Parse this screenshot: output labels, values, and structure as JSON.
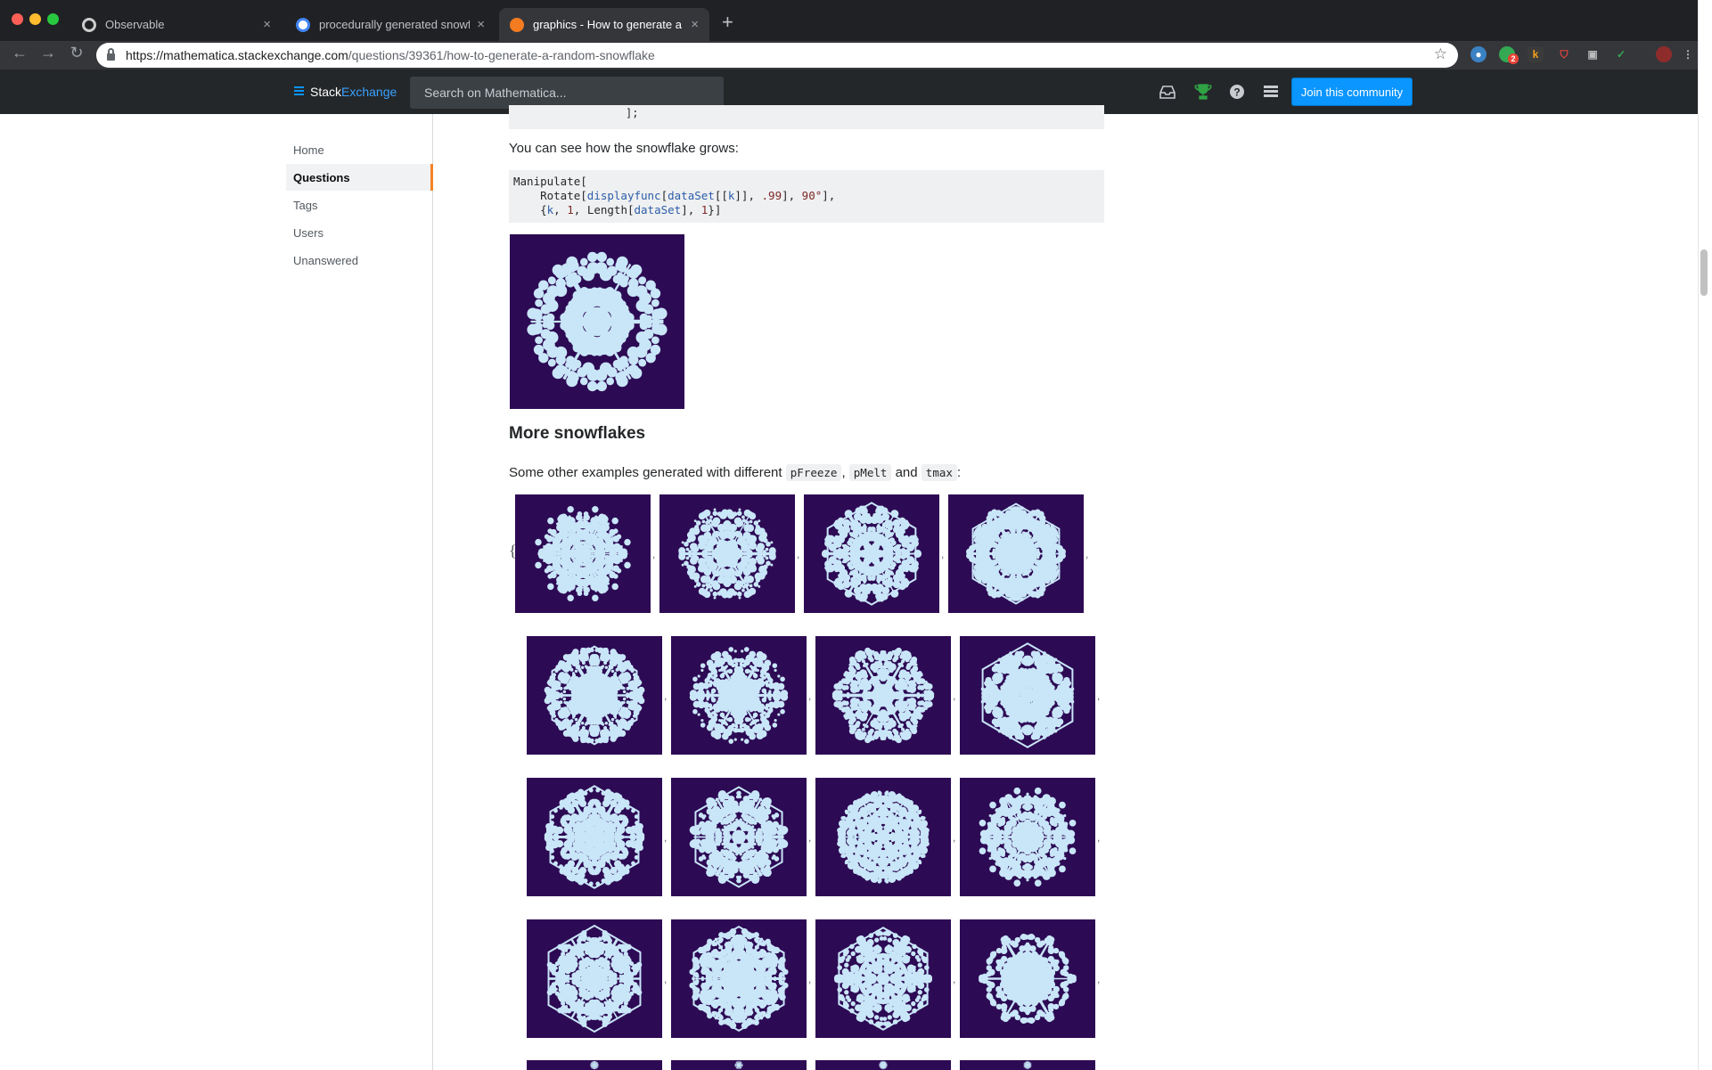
{
  "browser": {
    "tabs": [
      {
        "title": "Observable",
        "active": false
      },
      {
        "title": "procedurally generated snowfl",
        "active": false
      },
      {
        "title": "graphics - How to generate a r",
        "active": true
      }
    ],
    "url_host": "https://mathematica.stackexchange.com",
    "url_path": "/questions/39361/how-to-generate-a-random-snowflake",
    "extension_badge": "2"
  },
  "topbar": {
    "logo_prefix": "Stack",
    "logo_suffix": "Exchange",
    "search_placeholder": "Search on Mathematica...",
    "join_label": "Join this community",
    "icons": [
      "inbox-icon",
      "achievements-icon",
      "help-icon",
      "site-switcher-icon"
    ]
  },
  "sidebar": {
    "items": [
      {
        "label": "Home",
        "active": false
      },
      {
        "label": "Questions",
        "active": true
      },
      {
        "label": "Tags",
        "active": false
      },
      {
        "label": "Users",
        "active": false
      },
      {
        "label": "Unanswered",
        "active": false
      }
    ]
  },
  "post": {
    "code_tail": "];",
    "grow_text": "You can see how the snowflake grows:",
    "manipulate_code": {
      "line1": "Manipulate[",
      "line2_a": "    Rotate[",
      "line2_fn": "displayfunc",
      "line2_b": "[",
      "line2_ds": "dataSet",
      "line2_c": "[[",
      "line2_k": "k",
      "line2_d": "]], ",
      "line2_n1": ".99",
      "line2_e": "], ",
      "line2_n2": "90°",
      "line2_f": "],",
      "line3_a": "    {",
      "line3_k": "k",
      "line3_b": ", ",
      "line3_n1": "1",
      "line3_c": ", Length[",
      "line3_ds": "dataSet",
      "line3_d": "], ",
      "line3_n2": "1",
      "line3_e": "}]"
    },
    "section_heading": "More snowflakes",
    "examples_intro": "Some other examples generated with different",
    "param1": "pFreeze",
    "comma": ",",
    "param2": "pMelt",
    "and": "and",
    "param3": "tmax",
    "colon": ":",
    "brace_open": "{"
  },
  "colors": {
    "snow_bg": "#2d0a54",
    "snow_fg": "#c9e6f8",
    "accent": "#0a95ff",
    "active_marker": "#f48225"
  }
}
